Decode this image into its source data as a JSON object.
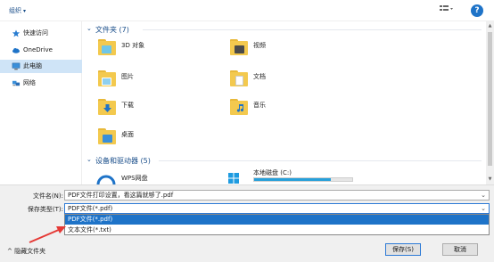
{
  "toolbar": {
    "organize_label": "组织",
    "organize_caret": "▾",
    "view_icon": "details-view-icon",
    "help_label": "?"
  },
  "sidebar": {
    "items": [
      {
        "label": "快速访问",
        "icon": "star-icon"
      },
      {
        "label": "OneDrive",
        "icon": "cloud-icon"
      },
      {
        "label": "此电脑",
        "icon": "computer-icon"
      },
      {
        "label": "网络",
        "icon": "network-icon"
      }
    ]
  },
  "main": {
    "folders_header": "文件夹 (7)",
    "folders": [
      {
        "label": "3D 对象"
      },
      {
        "label": "视频"
      },
      {
        "label": "图片"
      },
      {
        "label": "文档"
      },
      {
        "label": "下载"
      },
      {
        "label": "音乐"
      },
      {
        "label": "桌面"
      }
    ],
    "devices_header": "设备和驱动器 (5)",
    "devices": [
      {
        "label": "WPS网盘"
      },
      {
        "label": "本地磁盘 (C:)"
      }
    ]
  },
  "form": {
    "filename_label": "文件名(N):",
    "filename_value": "PDF文件打印设置，看这篇就够了.pdf",
    "filetype_label": "保存类型(T):",
    "filetype_value": "PDF文件(*.pdf)",
    "filetype_options": [
      "PDF文件(*.pdf)",
      "文本文件(*.txt)"
    ],
    "hide_folders_label": "隐藏文件夹",
    "save_label": "保存(S)",
    "cancel_label": "取消"
  },
  "colors": {
    "accent": "#1e73c8",
    "folder": "#f3c94e",
    "arrow": "#e53935"
  }
}
